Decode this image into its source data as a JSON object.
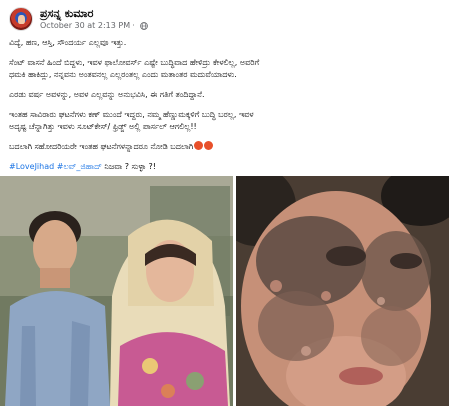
{
  "post": {
    "author": "ಪ್ರಸನ್ನ ಕುಮಾರ",
    "timestamp": "October 30 at 2:13 PM",
    "privacy_icon": "globe-icon",
    "paragraphs": [
      "ವಿದ್ಯೆ, ಹಣ, ಆಸ್ತಿ, ಸೌಂದರ್ಯ ಎಲ್ಲವೂ ಇತ್ತು.",
      "ಸೆಂಟ್ ವಾಸನೆ ಹಿಂದೆ ಬಿದ್ದಳು, ಇವಳ ಫಾಲೋವರ್ಸ್ ಎಷ್ಟೇ ಬುದ್ಧಿವಾದ ಹೇಳಿದ್ರು ಕೇಳಲಿಲ್ಲ, ಅವರಿಗೆ",
      "ಧಮಕಿ ಹಾಕಿದ್ಲು, ನನ್ನವನು ಅಂತವನಲ್ಲ ಎಲ್ಲರಂತಲ್ಲ ಎಂದು ಮತಾಂತರ ಮದುವೆಯಾದಳು.",
      "ಎರಡು ವರ್ಷ ಅವಳನ್ನು, ಅವಳ ಎಲ್ಲವನ್ನು ಅನುಭವಿಸಿ, ಈ ಗತಿಗೆ ತಂದಿದ್ದಾನೆ.",
      "ಇಂತಹ ಸಾವಿರಾರು ಘಟನೆಗಳು ಕಣ್ ಮುಂದೆ ಇದ್ದರು, ನಮ್ಮ ಹೆಣ್ಣುಮಕ್ಕಳಿಗೆ ಬುದ್ಧಿ ಬರಲ್ಲ, ಇವಳ",
      "ಅದೃಷ್ಟ ಚೆನ್ನಾಗಿತ್ತು ಇವಳು ಸೂಟ್‌ಕೇಸ್/ ಫ್ರಿಡ್ಜ್ ಅಲ್ಲಿ ಪಾರ್ಸಲ್ ಆಗಲಿಲ್ಲ!!",
      "ಬದಲಾಗಿ ಸಹೋದರಿಯರೇ ಇಂತಹ ಘಟನೆಗಳನ್ನಾದರೂ ನೋಡಿ ಬದಲಾಗಿ"
    ],
    "hashtags": [
      "#LoveJihad",
      "#ಲವ್_ಜಿಹಾದ್"
    ],
    "tail_text": "ನಿಜವಾ ? ಸುಳ್ಳಾ ?!",
    "emoji_icons": [
      "angry-face-icon",
      "angry-face-icon"
    ]
  }
}
